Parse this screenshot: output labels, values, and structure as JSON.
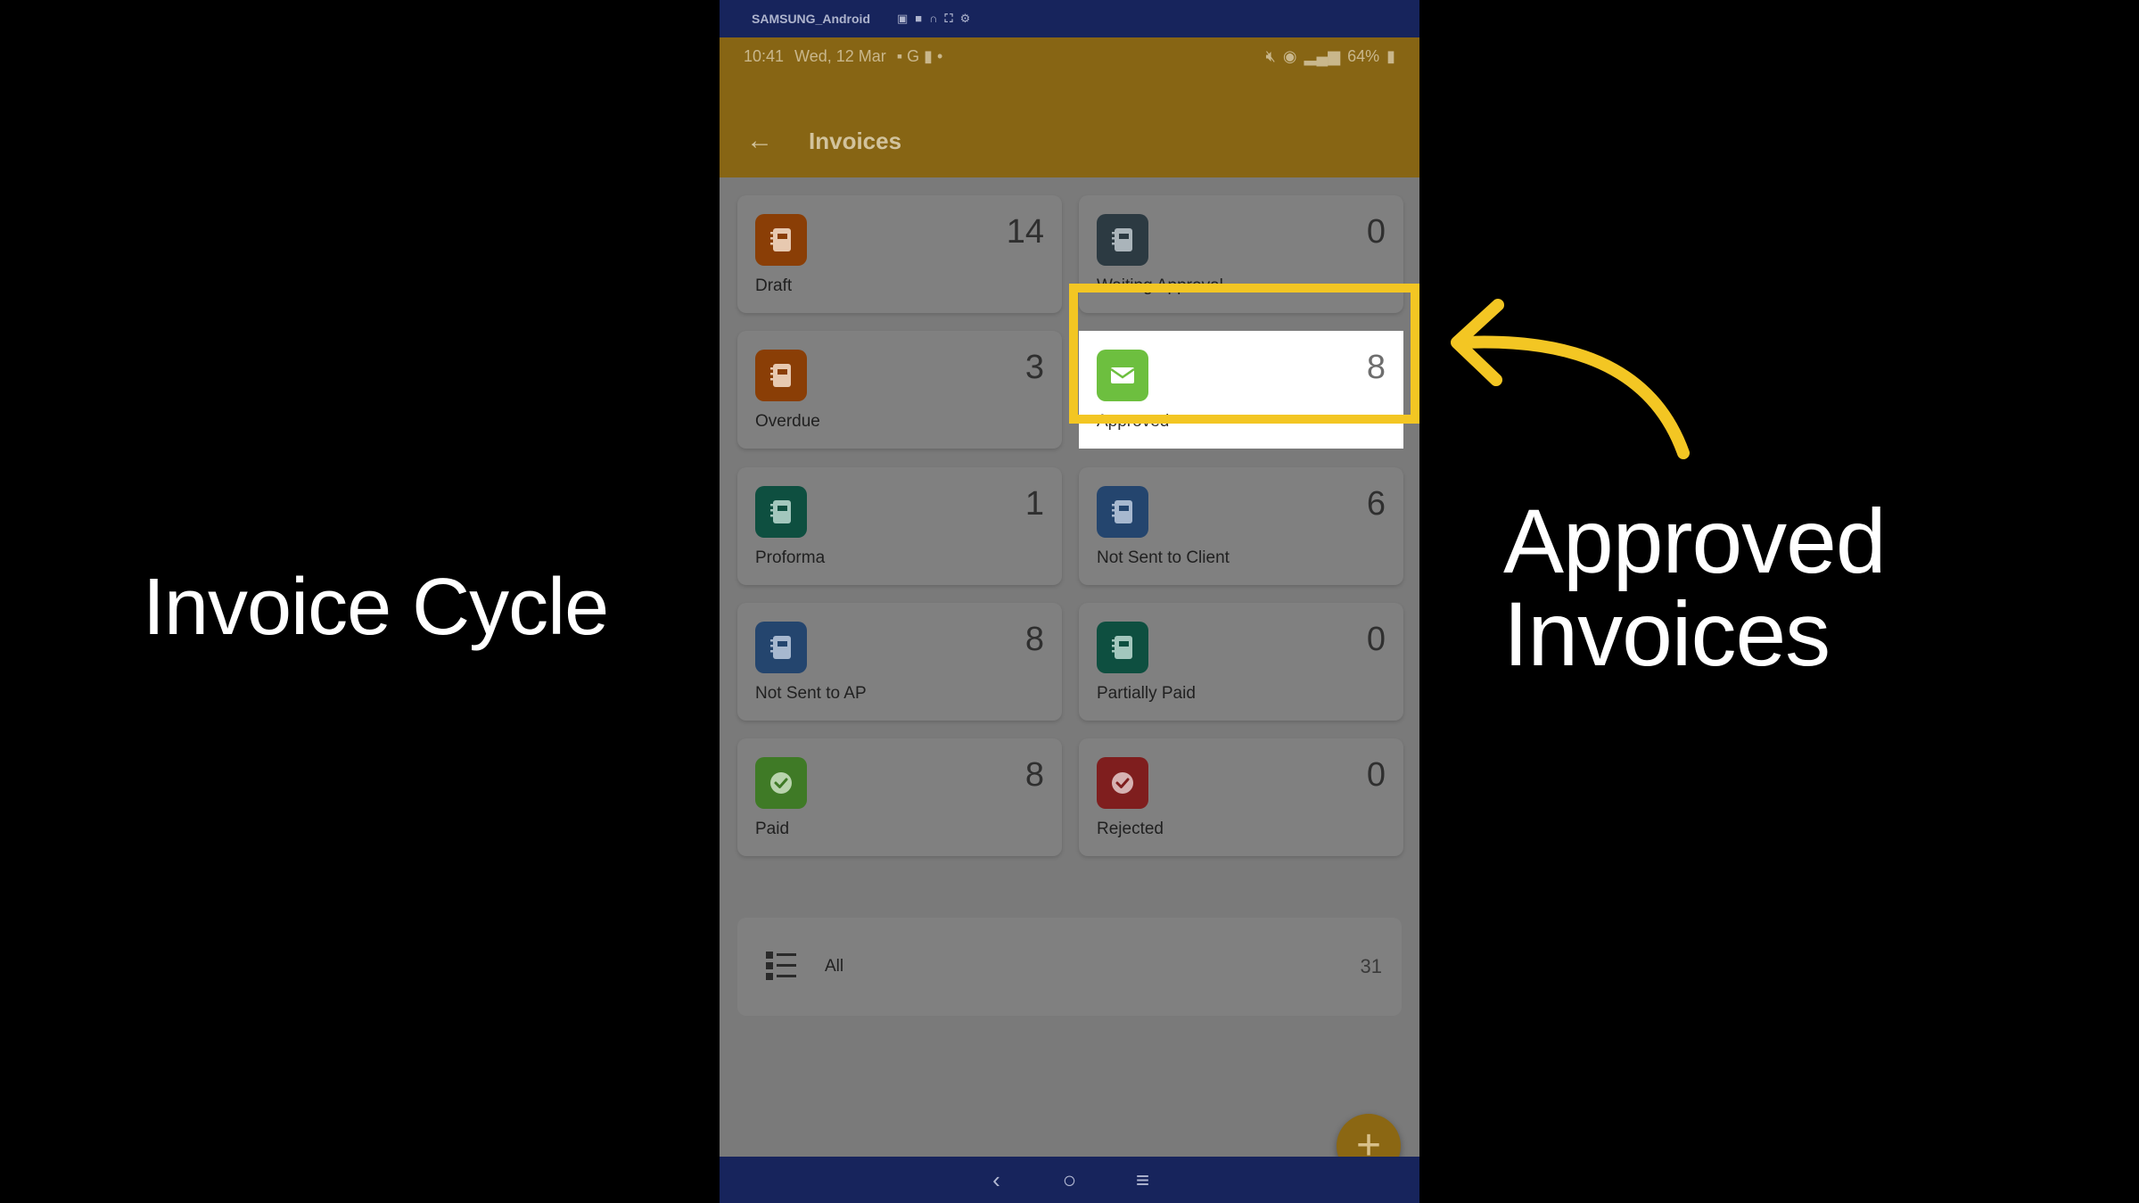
{
  "captions": {
    "left": "Invoice Cycle",
    "right_line1": "Approved",
    "right_line2": "Invoices"
  },
  "device": {
    "name": "SAMSUNG_Android",
    "time": "10:41",
    "date": "Wed, 12 Mar",
    "battery": "64%"
  },
  "toolbar": {
    "title": "Invoices"
  },
  "tiles": [
    {
      "label": "Draft",
      "count": "14",
      "icon": "notebook-icon",
      "color": "#8a3e06"
    },
    {
      "label": "Waiting Approval",
      "count": "0",
      "icon": "notebook-icon",
      "color": "#2c3a42"
    },
    {
      "label": "Overdue",
      "count": "3",
      "icon": "notebook-icon",
      "color": "#8a3e06"
    },
    {
      "label": "Approved",
      "count": "8",
      "icon": "envelope-icon",
      "color": "#6dbf3f"
    },
    {
      "label": "Proforma",
      "count": "1",
      "icon": "notebook-icon",
      "color": "#0e4f40"
    },
    {
      "label": "Not Sent to Client",
      "count": "6",
      "icon": "notebook-icon",
      "color": "#24456e"
    },
    {
      "label": "Not Sent to AP",
      "count": "8",
      "icon": "notebook-icon",
      "color": "#24456e"
    },
    {
      "label": "Partially Paid",
      "count": "0",
      "icon": "notebook-icon",
      "color": "#0e4f40"
    },
    {
      "label": "Paid",
      "count": "8",
      "icon": "check-circle-icon",
      "color": "#3f7a26"
    },
    {
      "label": "Rejected",
      "count": "0",
      "icon": "check-circle-icon",
      "color": "#7f1e1e"
    }
  ],
  "all": {
    "label": "All",
    "count": "31",
    "icon": "list-icon"
  },
  "fab": {
    "icon": "plus-icon",
    "symbol": "+"
  },
  "nav": {
    "back": "‹",
    "home": "○",
    "recents": "≡"
  },
  "colors": {
    "highlight": "#f3c623",
    "accent_bar": "#f0b429",
    "system_bar": "#17245c"
  }
}
